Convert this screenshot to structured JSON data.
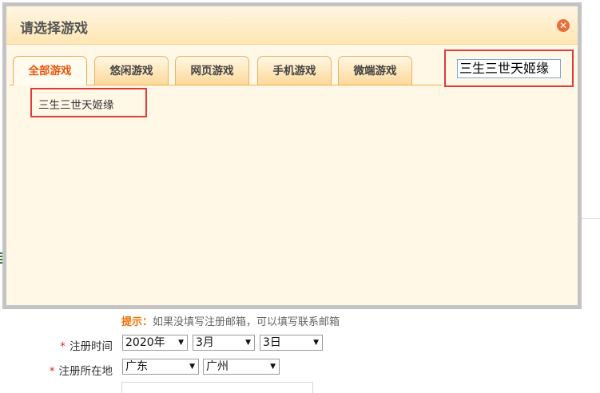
{
  "dialog": {
    "title": "请选择游戏",
    "close_icon": "close-icon",
    "tabs": [
      {
        "label": "全部游戏",
        "active": true
      },
      {
        "label": "悠闲游戏",
        "active": false
      },
      {
        "label": "网页游戏",
        "active": false
      },
      {
        "label": "手机游戏",
        "active": false
      },
      {
        "label": "微端游戏",
        "active": false
      }
    ],
    "search": {
      "value": "三生三世天姬缘"
    },
    "results": [
      "三生三世天姬缘"
    ]
  },
  "form": {
    "hint_prefix": "提示：",
    "hint_text": "如果没填写注册邮箱，可以填写联系邮箱",
    "required_mark": "*",
    "reg_time_label": "注册时间",
    "year": "2020年",
    "month": "3月",
    "day": "3日",
    "reg_location_label": "注册所在地",
    "province": "广东",
    "city": "广州"
  },
  "colors": {
    "accent": "#e8570c",
    "highlight_border": "#e03a3a",
    "dialog_bg": "#fff8e7"
  }
}
